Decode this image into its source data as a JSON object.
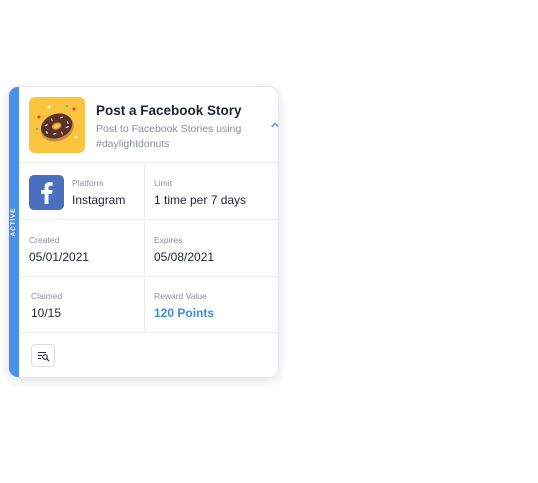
{
  "card": {
    "status": "ACTIVE",
    "title": "Post a Facebook Story",
    "subtitle": "Post to Facebook Stories using #daylightdonuts",
    "thumbnail_icon": "donut-icon",
    "expand_icon": "chevron-up-icon",
    "platform": {
      "label": "Platform",
      "value": "Instagram",
      "icon": "facebook-icon"
    },
    "limit": {
      "label": "Limit",
      "value": "1 time per 7 days"
    },
    "created": {
      "label": "Created",
      "value": "05/01/2021"
    },
    "expires": {
      "label": "Expires",
      "value": "05/08/2021"
    },
    "claimed": {
      "label": "Claimed",
      "value": "10/15"
    },
    "reward": {
      "label": "Reward Value",
      "value": "120 Points"
    },
    "footer_button_icon": "search-list-icon"
  },
  "colors": {
    "accent": "#4a90e8",
    "reward_text": "#3a8ee6",
    "thumbnail_bg": "#fbc43f",
    "facebook_blue": "#4a6fbf"
  }
}
